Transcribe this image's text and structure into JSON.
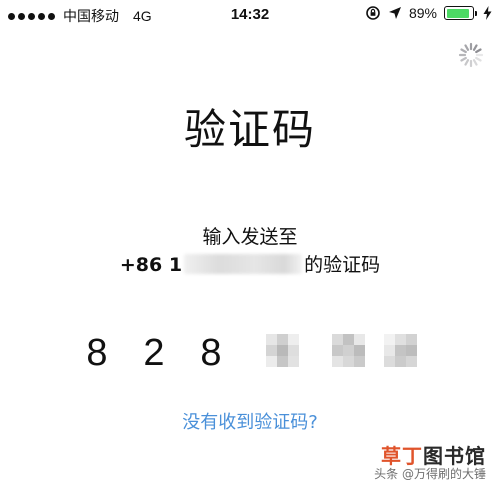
{
  "status_bar": {
    "carrier": "中国移动",
    "network": "4G",
    "time": "14:32",
    "battery_percent": "89%",
    "battery_level": 0.89,
    "icons": [
      "signal-dots-icon",
      "lock-rotation-icon",
      "location-arrow-icon",
      "battery-icon",
      "charging-bolt-icon"
    ],
    "battery_color": "#4cd964"
  },
  "page": {
    "title": "验证码",
    "subtitle_line1": "输入发送至",
    "phone_prefix": "+86 1",
    "subtitle_suffix": "的验证码",
    "resend_link": "没有收到验证码?",
    "link_color": "#4a90d9"
  },
  "code": {
    "digits": [
      "8",
      "2",
      "8"
    ],
    "hidden_count": 3
  },
  "watermark": {
    "site_a": "草丁",
    "site_b": "图书馆",
    "author": "头条 @万得刷的大锤"
  }
}
